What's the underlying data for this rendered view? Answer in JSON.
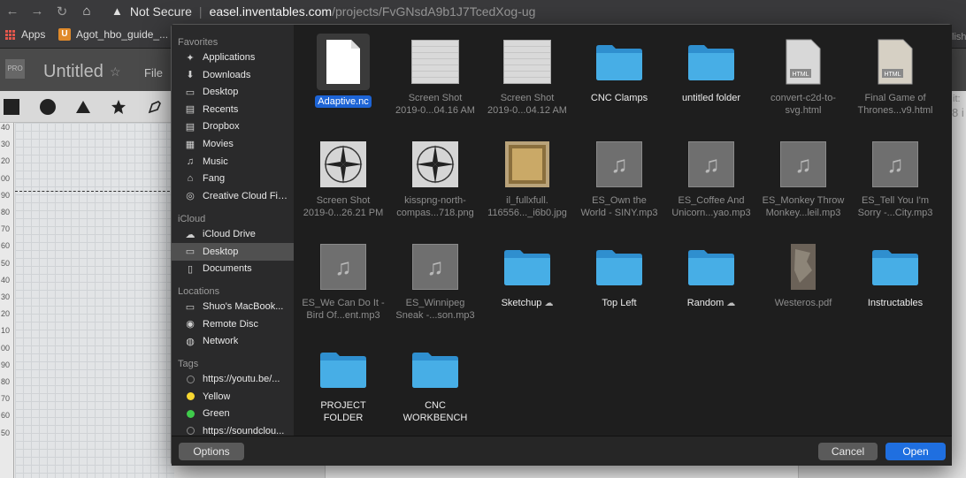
{
  "browser": {
    "nav_icons": [
      "back-arrow-icon",
      "forward-arrow-icon",
      "reload-icon",
      "home-icon"
    ],
    "security_label": "Not Secure",
    "url_host": "easel.inventables.com",
    "url_path": "/projects/FvGNsdA9b1J7TcedXog-ug",
    "bookmarks": [
      {
        "label": "Apps",
        "icon": "apps-grid-icon"
      },
      {
        "label": "Agot_hbo_guide_...",
        "icon": "bookmark-favicon"
      }
    ]
  },
  "app": {
    "pro_badge": "PRO",
    "title": "Untitled",
    "file_menu": "File",
    "right_edge_text": [
      "lish",
      "it:",
      "8 i"
    ]
  },
  "ruler_labels": [
    "40",
    "30",
    "20",
    "00",
    "90",
    "80",
    "70",
    "60",
    "50",
    "40",
    "30",
    "20",
    "10",
    "00",
    "90",
    "80",
    "70",
    "60",
    "50"
  ],
  "dialog": {
    "sidebar": {
      "favorites_header": "Favorites",
      "favorites": [
        {
          "label": "Applications",
          "icon": "applications-icon"
        },
        {
          "label": "Downloads",
          "icon": "downloads-icon"
        },
        {
          "label": "Desktop",
          "icon": "desktop-icon"
        },
        {
          "label": "Recents",
          "icon": "recents-icon"
        },
        {
          "label": "Dropbox",
          "icon": "dropbox-icon"
        },
        {
          "label": "Movies",
          "icon": "movies-icon"
        },
        {
          "label": "Music",
          "icon": "music-icon"
        },
        {
          "label": "Fang",
          "icon": "home-folder-icon"
        },
        {
          "label": "Creative Cloud Fil...",
          "icon": "creative-cloud-icon"
        }
      ],
      "icloud_header": "iCloud",
      "icloud": [
        {
          "label": "iCloud Drive",
          "icon": "cloud-icon"
        },
        {
          "label": "Desktop",
          "icon": "desktop-icon",
          "selected": true
        },
        {
          "label": "Documents",
          "icon": "documents-icon"
        }
      ],
      "locations_header": "Locations",
      "locations": [
        {
          "label": "Shuo's MacBook...",
          "icon": "laptop-icon"
        },
        {
          "label": "Remote Disc",
          "icon": "disc-icon"
        },
        {
          "label": "Network",
          "icon": "network-icon"
        }
      ],
      "tags_header": "Tags",
      "tags": [
        {
          "label": "https://youtu.be/...",
          "color": "#2a2a2b",
          "outline": true
        },
        {
          "label": "Yellow",
          "color": "#f7d731"
        },
        {
          "label": "Green",
          "color": "#3fcb4b"
        },
        {
          "label": "https://soundclou...",
          "color": "#2a2a2b",
          "outline": true
        }
      ]
    },
    "files": [
      {
        "line1": "Adaptive.nc",
        "line2": "",
        "kind": "doc",
        "selected": true
      },
      {
        "line1": "Screen Shot",
        "line2": "2019-0...04.16 AM",
        "kind": "thumb",
        "dim": true
      },
      {
        "line1": "Screen Shot",
        "line2": "2019-0...04.12 AM",
        "kind": "thumb",
        "dim": true
      },
      {
        "line1": "CNC Clamps",
        "line2": "",
        "kind": "folder"
      },
      {
        "line1": "untitled folder",
        "line2": "",
        "kind": "folder"
      },
      {
        "line1": "convert-c2d-to-",
        "line2": "svg.html",
        "kind": "html",
        "dim": true
      },
      {
        "line1": "Final Game of",
        "line2": "Thrones...v9.html",
        "kind": "html-map",
        "dim": true
      },
      {
        "line1": "Screen Shot",
        "line2": "2019-0...26.21 PM",
        "kind": "compass",
        "dim": true
      },
      {
        "line1": "kisspng-north-",
        "line2": "compas...718.png",
        "kind": "compass",
        "dim": true
      },
      {
        "line1": "il_fullxfull.",
        "line2": "116556..._i6b0.jpg",
        "kind": "picture",
        "dim": true
      },
      {
        "line1": "ES_Own the",
        "line2": "World - SINY.mp3",
        "kind": "audio",
        "dim": true
      },
      {
        "line1": "ES_Coffee And",
        "line2": "Unicorn...yao.mp3",
        "kind": "audio",
        "dim": true
      },
      {
        "line1": "ES_Monkey Throw",
        "line2": "Monkey...leil.mp3",
        "kind": "audio",
        "dim": true
      },
      {
        "line1": "ES_Tell You I'm",
        "line2": "Sorry -...City.mp3",
        "kind": "audio",
        "dim": true
      },
      {
        "line1": "ES_We Can Do It -",
        "line2": "Bird Of...ent.mp3",
        "kind": "audio",
        "dim": true
      },
      {
        "line1": "ES_Winnipeg",
        "line2": "Sneak -...son.mp3",
        "kind": "audio",
        "dim": true
      },
      {
        "line1": "Sketchup",
        "line2": "",
        "kind": "folder",
        "cloud": true
      },
      {
        "line1": "Top Left",
        "line2": "",
        "kind": "folder"
      },
      {
        "line1": "Random",
        "line2": "",
        "kind": "folder",
        "cloud": true
      },
      {
        "line1": "Westeros.pdf",
        "line2": "",
        "kind": "pdf",
        "dim": true
      },
      {
        "line1": "Instructables",
        "line2": "",
        "kind": "folder"
      },
      {
        "line1": "PROJECT",
        "line2": "FOLDER",
        "kind": "folder"
      },
      {
        "line1": "CNC",
        "line2": "WORKBENCH",
        "kind": "folder"
      }
    ],
    "html_badge": "HTML",
    "buttons": {
      "options": "Options",
      "cancel": "Cancel",
      "open": "Open"
    }
  }
}
